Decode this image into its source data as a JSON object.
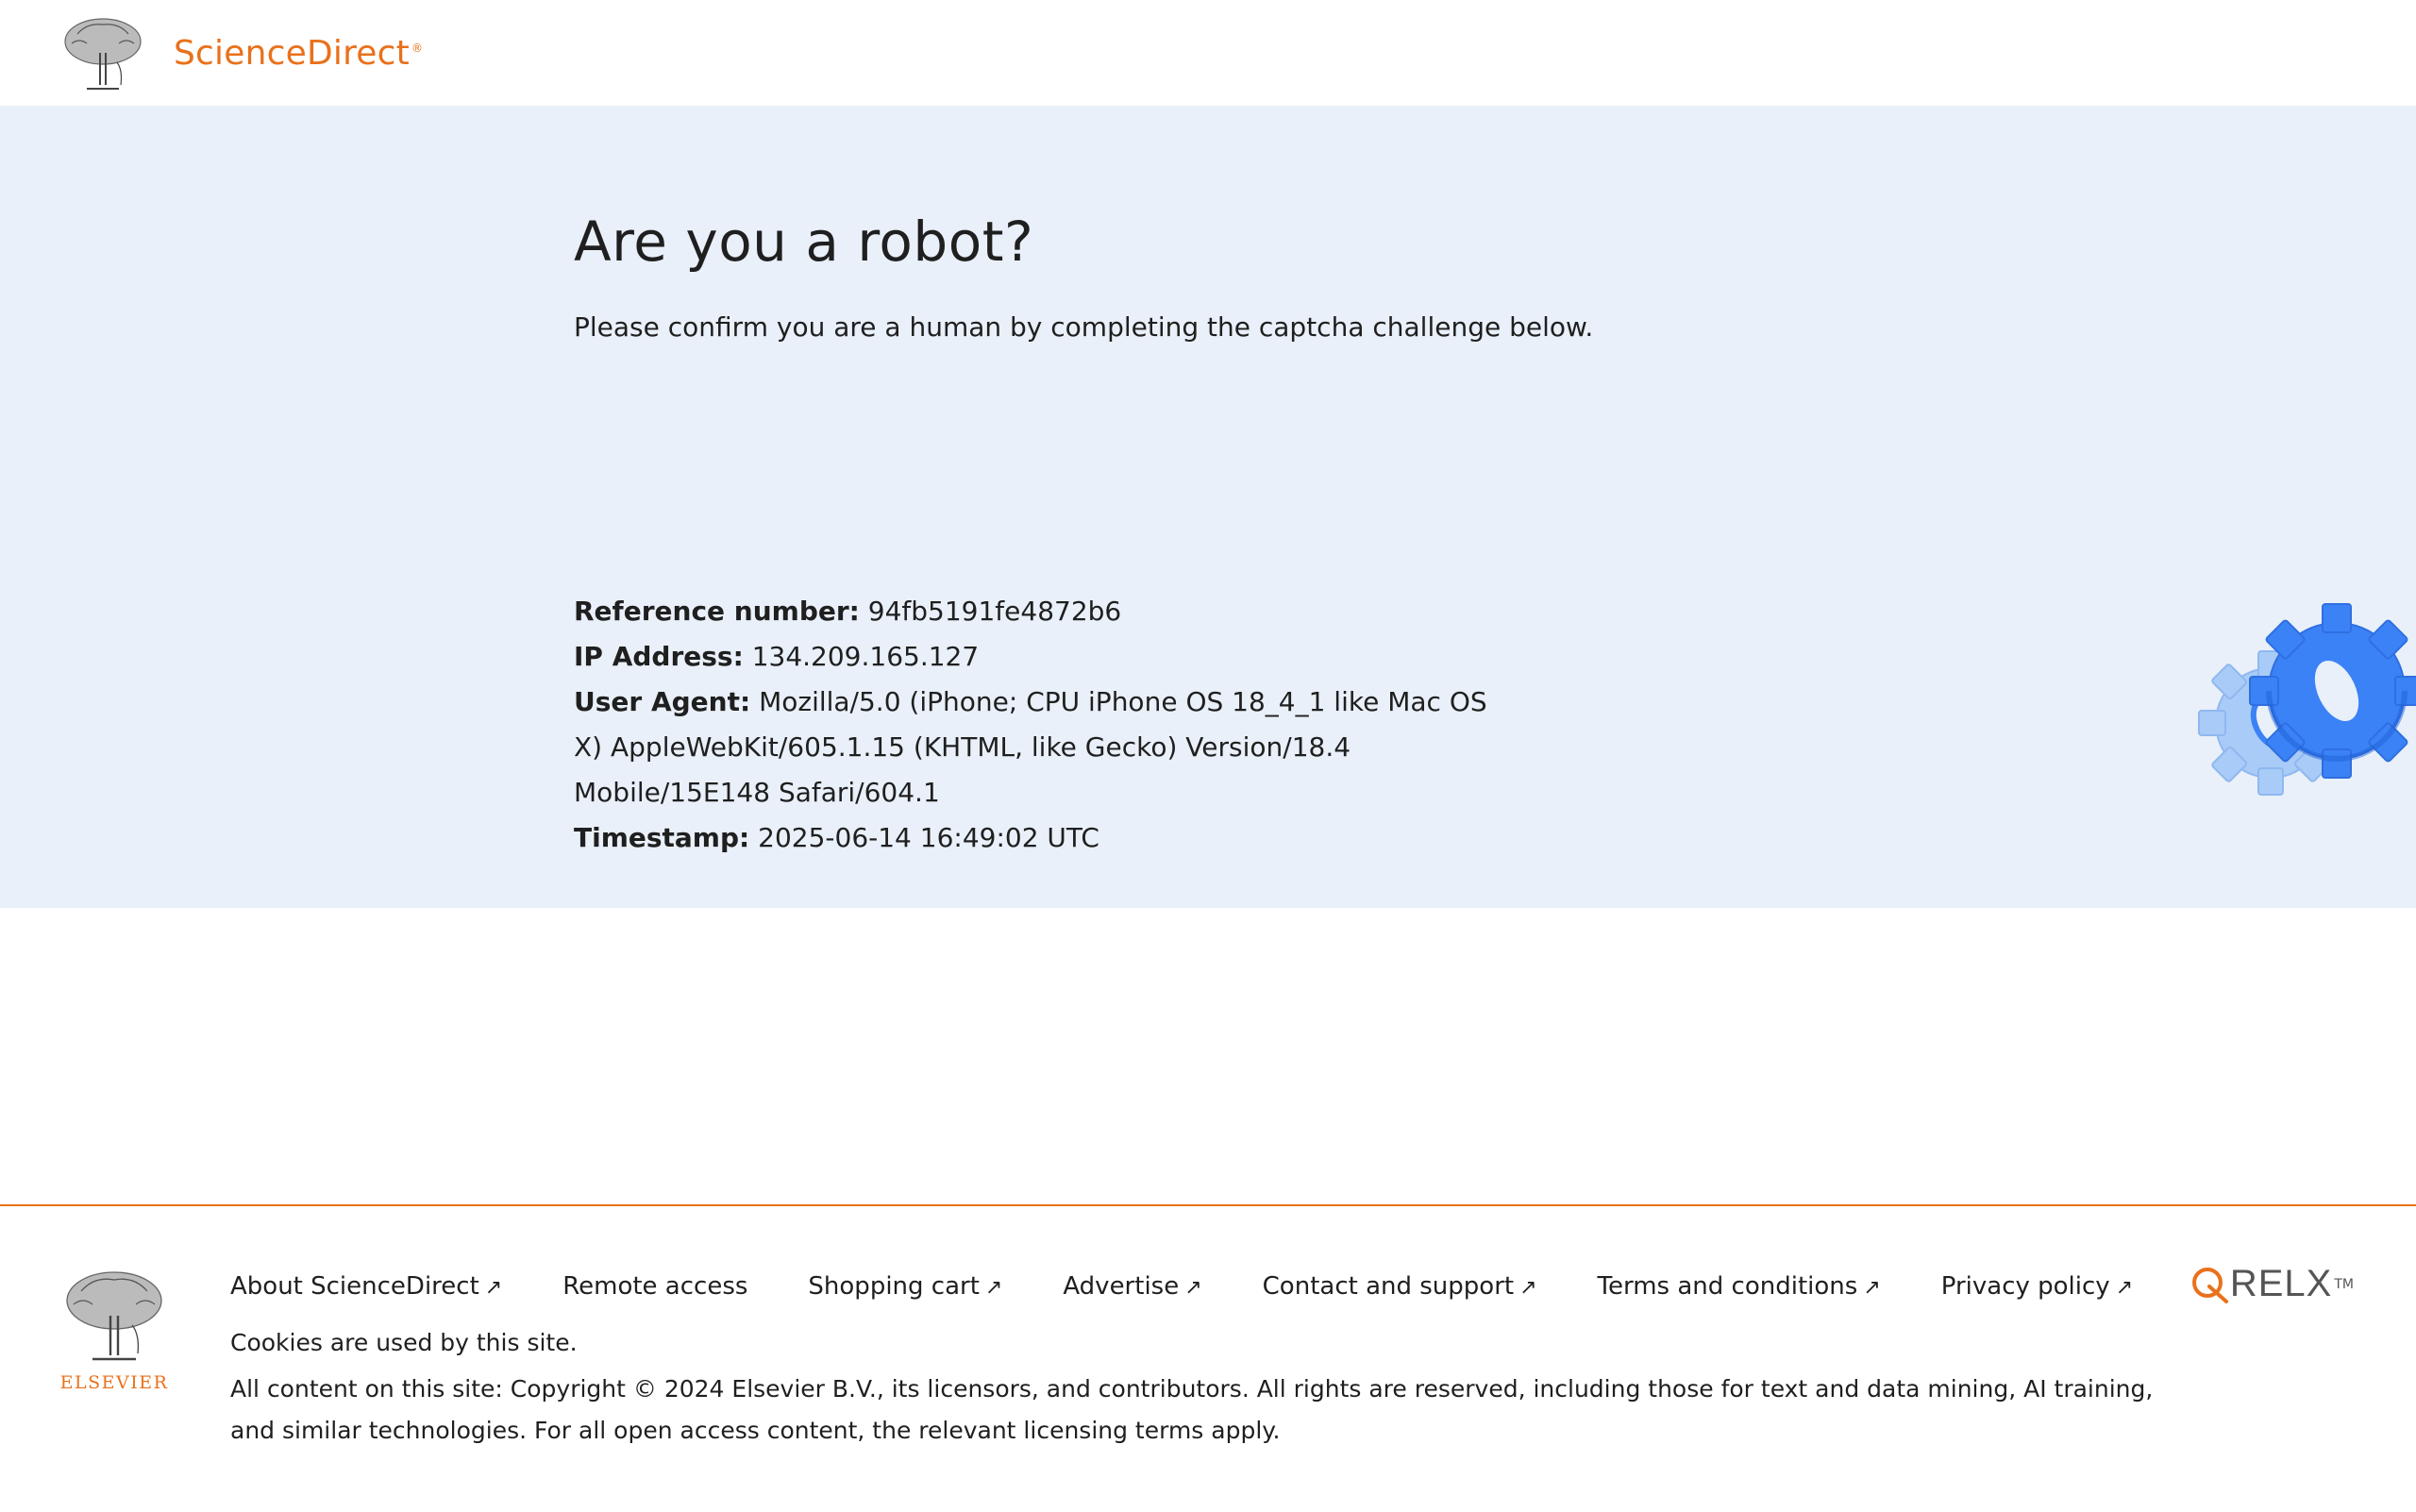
{
  "header": {
    "brand": "ScienceDirect",
    "brand_mark": "®"
  },
  "main": {
    "title": "Are you a robot?",
    "description": "Please confirm you are a human by completing the captcha challenge below.",
    "info": [
      {
        "label": "Reference number:",
        "value": "94fb5191fe4872b6"
      },
      {
        "label": "IP Address:",
        "value": "134.209.165.127"
      },
      {
        "label": "User Agent:",
        "value": "Mozilla/5.0 (iPhone; CPU iPhone OS 18_4_1 like Mac OS X) AppleWebKit/605.1.15 (KHTML, like Gecko) Version/18.4 Mobile/15E148 Safari/604.1"
      },
      {
        "label": "Timestamp:",
        "value": "2025-06-14 16:49:02 UTC"
      }
    ],
    "gear_icon": "gears-icon"
  },
  "footer": {
    "links": [
      {
        "label": "About ScienceDirect",
        "external": "↗"
      },
      {
        "label": "Remote access",
        "external": ""
      },
      {
        "label": "Shopping cart",
        "external": "↗"
      },
      {
        "label": "Advertise",
        "external": "↗"
      },
      {
        "label": "Contact and support",
        "external": "↗"
      },
      {
        "label": "Terms and conditions",
        "external": "↗"
      },
      {
        "label": "Privacy policy",
        "external": "↗"
      }
    ],
    "cookies": "Cookies are used by this site.",
    "copyright": "All content on this site: Copyright © 2024 Elsevier B.V., its licensors, and contributors. All rights are reserved, including those for text and data mining, AI training, and similar technologies. For all open access content, the relevant licensing terms apply.",
    "elsevier": "ELSEVIER",
    "relx": "RELX",
    "relx_tm": "TM"
  },
  "colors": {
    "brand_orange": "#e9711c",
    "band_bg": "#e9f0f9",
    "gear_blue": "#3b82f6",
    "gear_light": "#a9cbf7"
  }
}
